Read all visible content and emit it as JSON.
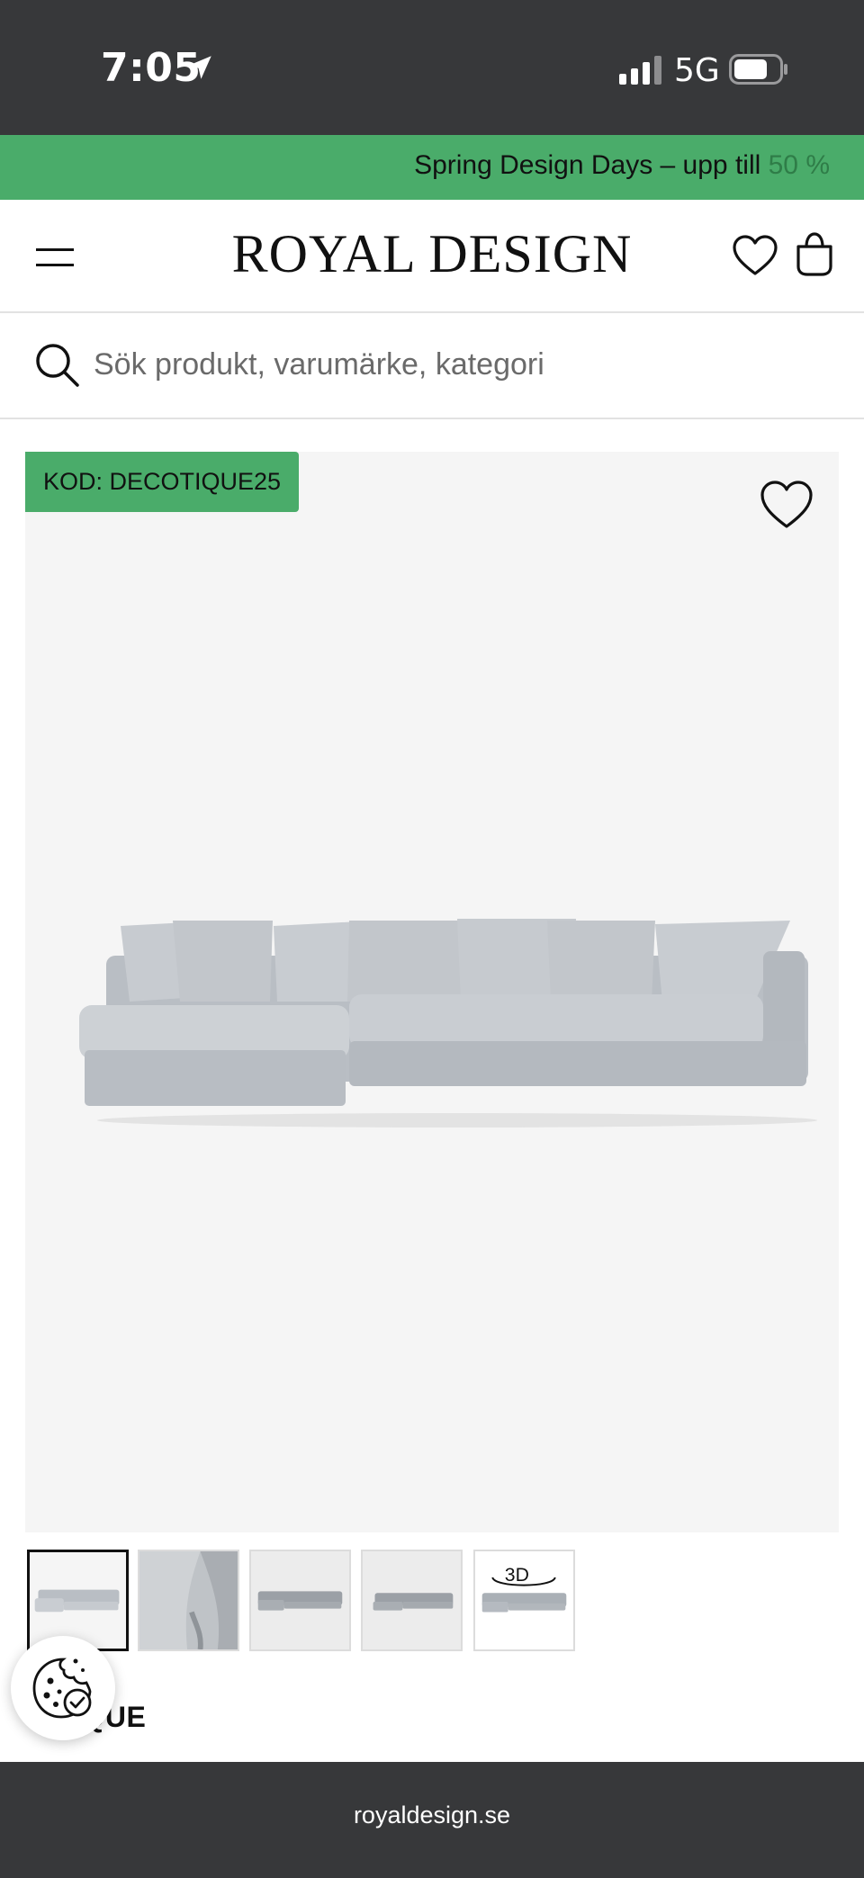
{
  "status_bar": {
    "time": "7:05",
    "network": "5G"
  },
  "promo_banner": {
    "text": "Spring Design Days – upp till ",
    "highlight": "50 %"
  },
  "header": {
    "brand": "ROYAL DESIGN"
  },
  "search": {
    "placeholder": "Sök produkt, varumärke, kategori"
  },
  "product": {
    "badge": "KOD: DECOTIQUE25",
    "brand_title": "TIQUE",
    "thumbnail_3d_label": "3D"
  },
  "browser": {
    "url": "royaldesign.se"
  },
  "colors": {
    "accent_green": "#4aac6a",
    "dark_bar": "#37383a"
  }
}
